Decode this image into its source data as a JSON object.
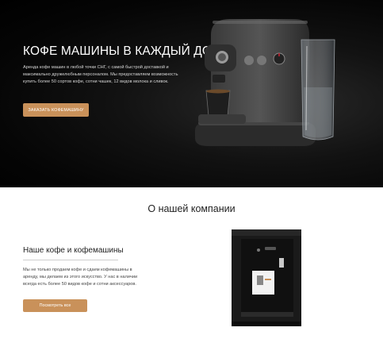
{
  "hero": {
    "title": "КОФЕ МАШИНЫ В КАЖДЫЙ ДОМ",
    "description": "Аренда кофе машин в любой точки СНГ, с самой быстрой доставкой и максимально дружелюбным персоналом. Мы предоставляем возможность купить более 50 сортов кофе, сотни чашек, 12 видов молока и сливок.",
    "cta_label": "ЗАКАЗАТЬ КОФЕМАШИНУ"
  },
  "about": {
    "section_title": "О нашей компании",
    "subtitle": "Наше кофе и кофемашины",
    "description": "Мы не только продаем кофе и сдаем кофемашины в аренду, мы делаем из этого искусство. У нас в наличии всегда есть более 50 видов кофе и сотни аксессуаров.",
    "button_label": "Посмотреть все"
  },
  "colors": {
    "accent": "#c9915a",
    "hero_background": "#000000",
    "page_background": "#ffffff"
  }
}
